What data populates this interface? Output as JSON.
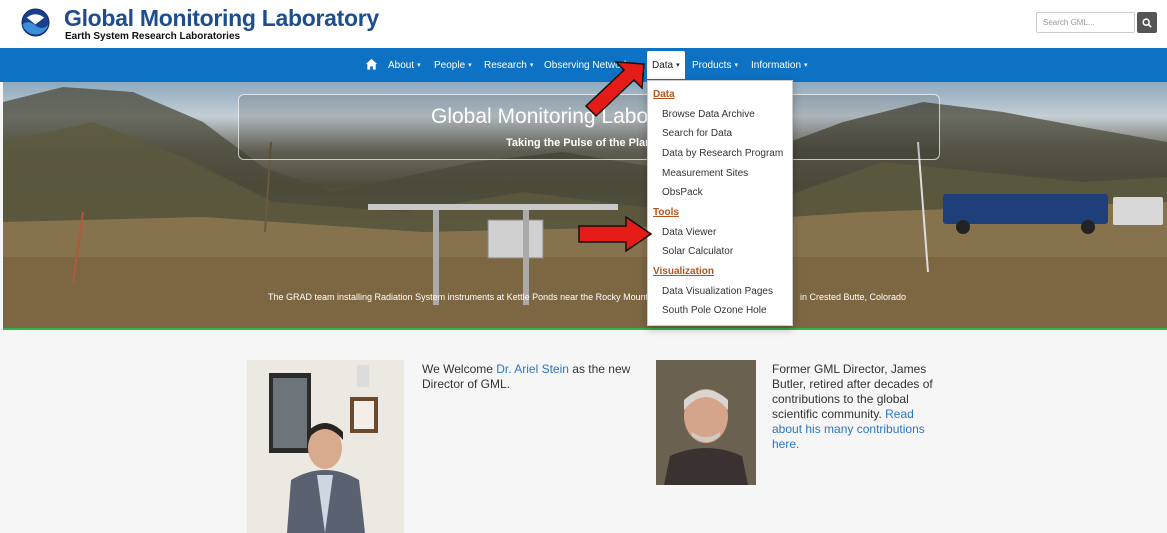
{
  "header": {
    "title": "Global Monitoring Laboratory",
    "subtitle": "Earth System Research Laboratories",
    "search_placeholder": "Search GML..."
  },
  "nav": {
    "items": [
      {
        "label": "About",
        "caret": "▾"
      },
      {
        "label": "People",
        "caret": "▾"
      },
      {
        "label": "Research",
        "caret": "▾"
      },
      {
        "label": "Observing Networks",
        "caret": "▾"
      },
      {
        "label": "Data",
        "caret": "▾"
      },
      {
        "label": "Products",
        "caret": "▾"
      },
      {
        "label": "Information",
        "caret": "▾"
      }
    ]
  },
  "hero": {
    "title": "Global Monitoring Laboratory",
    "tagline": "Taking the Pulse of the Planet",
    "caption": "The GRAD team installing Radiation System instruments at Kettle Ponds near the Rocky Mountain Biological Laboratory",
    "caption_end": "in Crested Butte, Colorado"
  },
  "dropdown": {
    "sections": [
      {
        "header": "Data",
        "items": [
          "Browse Data Archive",
          "Search for Data",
          "Data by Research Program",
          "Measurement Sites",
          "ObsPack"
        ]
      },
      {
        "header": "Tools",
        "items": [
          "Data Viewer",
          "Solar Calculator"
        ]
      },
      {
        "header": "Visualization",
        "items": [
          "Data Visualization Pages",
          "South Pole Ozone Hole"
        ]
      }
    ]
  },
  "news": [
    {
      "pre": "We Welcome ",
      "link": "Dr. Ariel Stein",
      "post": " as the new Director of GML."
    },
    {
      "pre": "Former GML Director, James Butler, retired after decades of contributions to the global scientific community. ",
      "link": "Read about his many contributions here.",
      "post": ""
    }
  ],
  "colors": {
    "brand_blue": "#1d4e8f",
    "navbar": "#0d72c4",
    "section_header": "#b5541e",
    "link": "#2a75c9",
    "annotation_arrow": "#e41b17"
  }
}
